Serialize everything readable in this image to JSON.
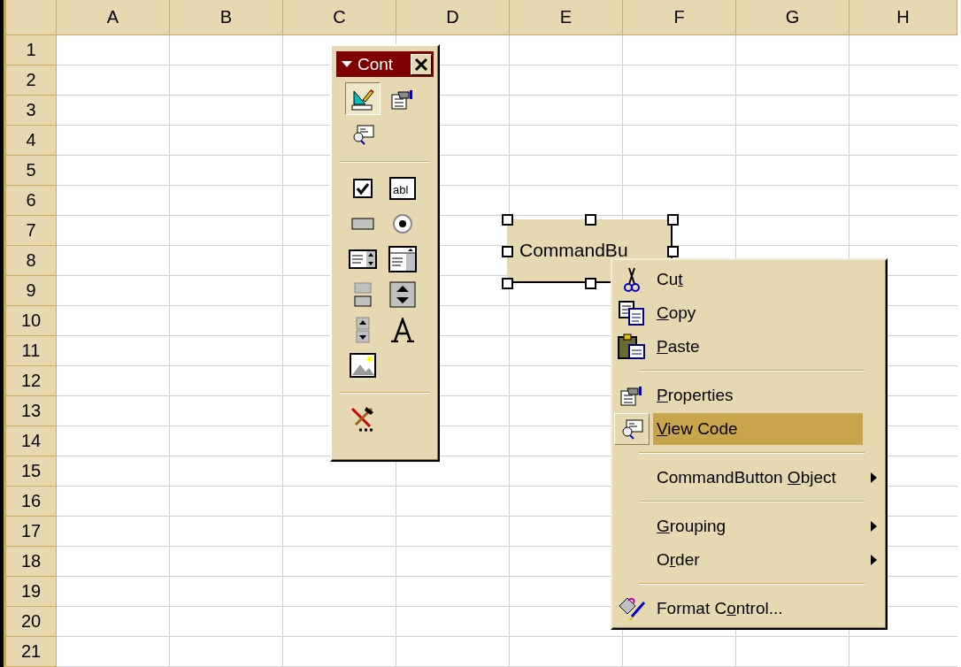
{
  "sheet": {
    "columns": [
      "A",
      "B",
      "C",
      "D",
      "E",
      "F",
      "G",
      "H"
    ],
    "rows": [
      "1",
      "2",
      "3",
      "4",
      "5",
      "6",
      "7",
      "8",
      "9",
      "10",
      "11",
      "12",
      "13",
      "14",
      "15",
      "16",
      "17",
      "18",
      "19",
      "20",
      "21"
    ]
  },
  "control_toolbox": {
    "title": "Cont",
    "groups": [
      [
        {
          "kind": "design-mode",
          "selected": true
        },
        {
          "kind": "properties",
          "selected": false
        },
        {
          "kind": "view-code",
          "selected": false
        }
      ],
      [
        {
          "kind": "checkbox",
          "selected": false
        },
        {
          "kind": "textbox",
          "caption": "abl",
          "selected": false
        },
        {
          "kind": "button",
          "selected": false
        },
        {
          "kind": "option",
          "selected": false
        },
        {
          "kind": "listbox",
          "selected": false
        },
        {
          "kind": "combobox",
          "selected": false
        },
        {
          "kind": "toggle",
          "selected": false
        },
        {
          "kind": "scrollbar",
          "selected": false
        },
        {
          "kind": "spinner",
          "selected": false
        },
        {
          "kind": "label",
          "selected": false
        },
        {
          "kind": "image",
          "selected": false
        }
      ],
      [
        {
          "kind": "more-controls",
          "selected": false
        }
      ]
    ]
  },
  "command_button": {
    "label": "CommandBu",
    "selected": true
  },
  "context_menu": {
    "items": [
      {
        "kind": "item",
        "label": [
          {
            "text": "Cu"
          },
          {
            "text": "t",
            "underline": true
          }
        ],
        "selected": false,
        "submenu": false
      },
      {
        "kind": "item",
        "label": [
          {
            "text": "C",
            "underline": true
          },
          {
            "text": "opy"
          }
        ],
        "selected": false,
        "submenu": false
      },
      {
        "kind": "item",
        "label": [
          {
            "text": "P",
            "underline": true
          },
          {
            "text": "aste"
          }
        ],
        "selected": false,
        "submenu": false
      },
      {
        "kind": "separator"
      },
      {
        "kind": "item",
        "label": [
          {
            "text": "P",
            "underline": true
          },
          {
            "text": "roperties"
          }
        ],
        "selected": false,
        "submenu": false
      },
      {
        "kind": "item",
        "label": [
          {
            "text": "V",
            "underline": true
          },
          {
            "text": "iew Code"
          }
        ],
        "selected": true,
        "submenu": false
      },
      {
        "kind": "separator"
      },
      {
        "kind": "item",
        "label": [
          {
            "text": "CommandButton "
          },
          {
            "text": "O",
            "underline": true
          },
          {
            "text": "bject"
          }
        ],
        "selected": false,
        "submenu": true
      },
      {
        "kind": "separator"
      },
      {
        "kind": "item",
        "label": [
          {
            "text": "G",
            "underline": true
          },
          {
            "text": "rouping"
          }
        ],
        "selected": false,
        "submenu": true
      },
      {
        "kind": "item",
        "label": [
          {
            "text": "O"
          },
          {
            "text": "r",
            "underline": true
          },
          {
            "text": "der"
          }
        ],
        "selected": false,
        "submenu": true
      },
      {
        "kind": "separator"
      },
      {
        "kind": "item",
        "label": [
          {
            "text": "Format C"
          },
          {
            "text": "o",
            "underline": true
          },
          {
            "text": "ntrol..."
          }
        ],
        "selected": false,
        "submenu": false
      }
    ]
  }
}
